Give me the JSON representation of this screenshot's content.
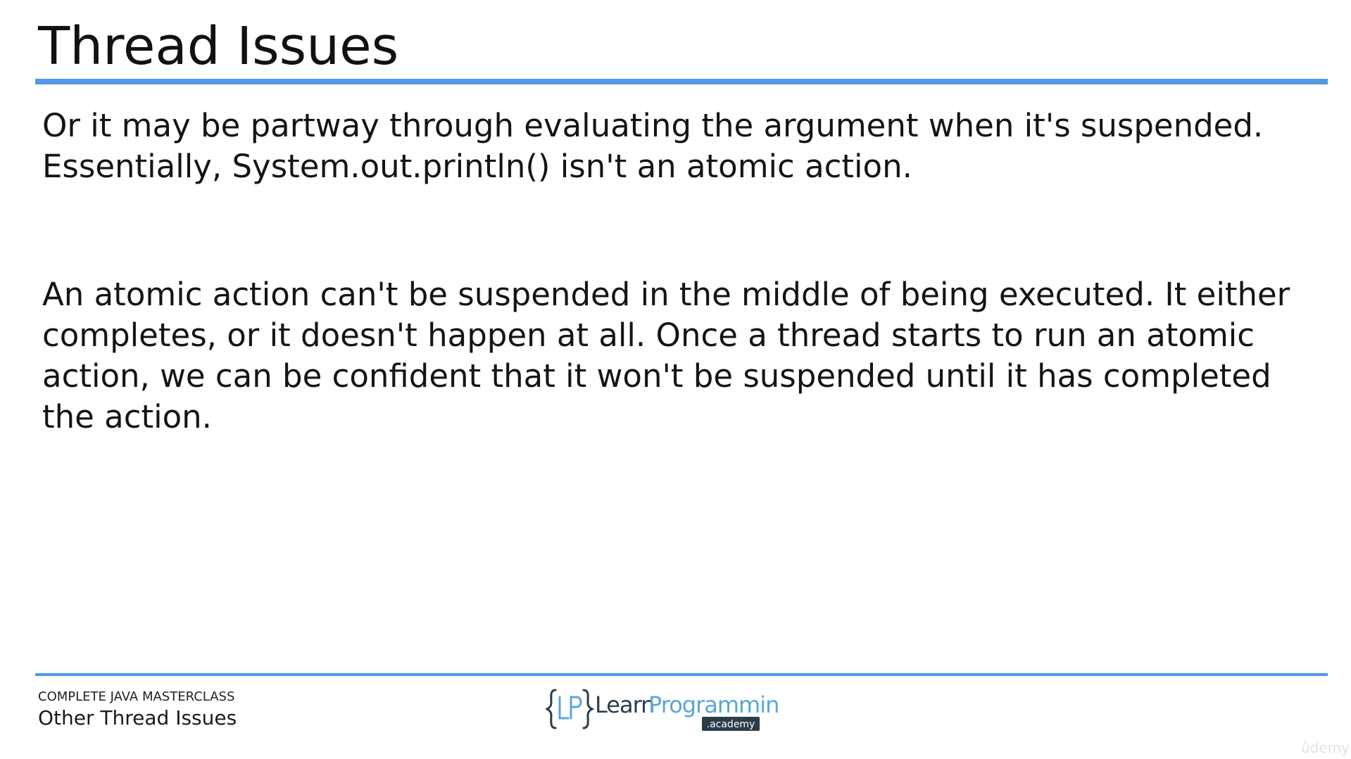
{
  "slide": {
    "title": "Thread Issues",
    "paragraphs": [
      "Or it may be partway through evaluating the argument when it's suspended. Essentially, System.out.println() isn't an atomic action.",
      "An atomic action can't be suspended in the middle of being executed. It either completes, or it doesn't happen at all. Once a thread starts to run an atomic action, we can be confident that it won't be suspended until it has completed the action."
    ]
  },
  "footer": {
    "course": "COMPLETE JAVA MASTERCLASS",
    "section": "Other Thread Issues",
    "logo_icon": "lp-brace-logo",
    "logo_text_left": "Learn",
    "logo_text_right": "Programming",
    "logo_badge": ".academy",
    "watermark": "ûdemy"
  },
  "colors": {
    "accent_blue": "#4e9ae5",
    "logo_dark": "#2b3d4b",
    "logo_light": "#5aa7d8"
  }
}
